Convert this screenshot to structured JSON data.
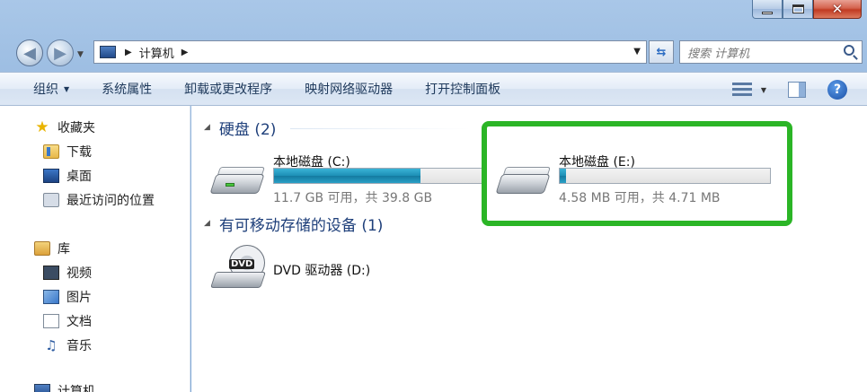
{
  "window": {
    "caption": {
      "minimize": "minimize",
      "maximize": "maximize",
      "close": "close"
    }
  },
  "nav": {
    "breadcrumb": "计算机",
    "search_placeholder": "搜索 计算机"
  },
  "toolbar": {
    "organize": "组织",
    "system_properties": "系统属性",
    "uninstall": "卸载或更改程序",
    "map_drive": "映射网络驱动器",
    "control_panel": "打开控制面板"
  },
  "sidebar": {
    "favorites": {
      "label": "收藏夹",
      "items": [
        "下载",
        "桌面",
        "最近访问的位置"
      ]
    },
    "libraries": {
      "label": "库",
      "items": [
        "视频",
        "图片",
        "文档",
        "音乐"
      ]
    },
    "computer": "计算机"
  },
  "content": {
    "hard_disks": {
      "header": "硬盘 (2)",
      "drives": [
        {
          "name": "本地磁盘 (C:)",
          "size_text": "11.7 GB 可用，共 39.8 GB",
          "used_fraction": 0.706
        },
        {
          "name": "本地磁盘 (E:)",
          "size_text": "4.58 MB 可用，共 4.71 MB",
          "used_fraction": 0.028
        }
      ]
    },
    "removable": {
      "header": "有可移动存储的设备 (1)",
      "drives": [
        {
          "name": "DVD 驱动器 (D:)",
          "icon_label": "DVD"
        }
      ]
    }
  },
  "colors": {
    "highlight": "#2bb526",
    "usage_bar": "#1d8fb6",
    "group_header": "#1e3f7a"
  }
}
